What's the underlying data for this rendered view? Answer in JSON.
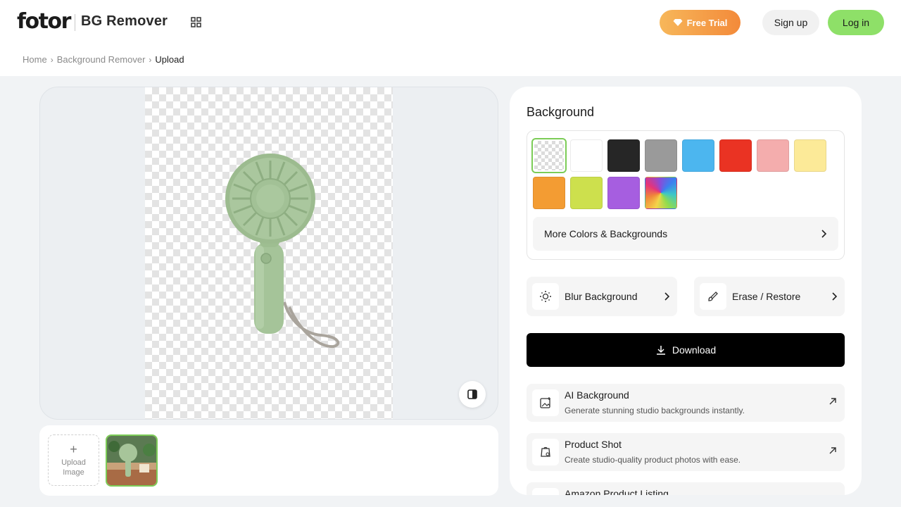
{
  "header": {
    "logo": "fotor",
    "product_name": "BG Remover",
    "free_trial_label": "Free Trial",
    "signup_label": "Sign up",
    "login_label": "Log in"
  },
  "breadcrumb": {
    "items": [
      "Home",
      "Background Remover",
      "Upload"
    ]
  },
  "upload": {
    "label": "Upload Image"
  },
  "panel": {
    "title": "Background",
    "swatches": [
      {
        "name": "transparent",
        "color": "transparent",
        "selected": true
      },
      {
        "name": "white",
        "color": "#ffffff"
      },
      {
        "name": "black",
        "color": "#262626"
      },
      {
        "name": "gray",
        "color": "#9a9a9a"
      },
      {
        "name": "blue",
        "color": "#4cb6ef"
      },
      {
        "name": "red",
        "color": "#ea3323"
      },
      {
        "name": "pink",
        "color": "#f4adad"
      },
      {
        "name": "yellow",
        "color": "#fcea98"
      },
      {
        "name": "orange",
        "color": "#f39c33"
      },
      {
        "name": "lime",
        "color": "#cde04d"
      },
      {
        "name": "purple",
        "color": "#a65ee0"
      },
      {
        "name": "rainbow",
        "color": "gradient"
      }
    ],
    "more_colors_label": "More Colors & Backgrounds",
    "blur_label": "Blur Background",
    "erase_label": "Erase / Restore",
    "download_label": "Download",
    "features": [
      {
        "title": "AI Background",
        "desc": "Generate stunning studio backgrounds instantly."
      },
      {
        "title": "Product Shot",
        "desc": "Create studio-quality product photos with ease."
      },
      {
        "title": "Amazon Product Listing",
        "desc": ""
      }
    ]
  },
  "colors": {
    "accent_green": "#8ee068",
    "selected_outline": "#7ccc57",
    "trial_gradient_start": "#f7b75a",
    "trial_gradient_end": "#f38a3a",
    "fan_green": "#a6c49a"
  }
}
